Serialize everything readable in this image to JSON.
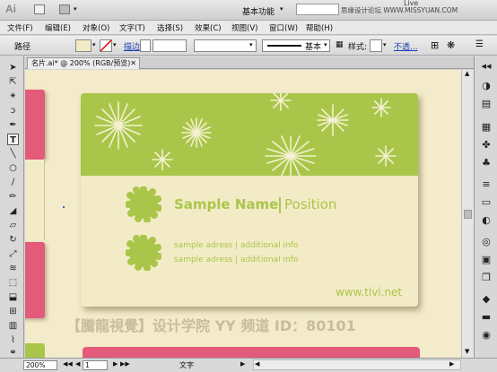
{
  "titlebar": {
    "logo": "Ai",
    "workspace": "基本功能",
    "watermark_site": "思缘设计论坛 WWW.MISSYUAN.COM",
    "live_label": "Live"
  },
  "menu": [
    "文件(F)",
    "编辑(E)",
    "对象(O)",
    "文字(T)",
    "选择(S)",
    "效果(C)",
    "视图(V)",
    "窗口(W)",
    "帮助(H)"
  ],
  "control": {
    "object_type": "路径",
    "stroke_label": "描边",
    "stroke_style": "基本",
    "opacity_style_label": "样式:",
    "opacity_label": "不透..."
  },
  "doc_tab": "名片.ai* @ 200% (RGB/预览)",
  "card": {
    "name": "Sample Name",
    "position": "Position",
    "address1": "sample adress | additional info",
    "address2": "sample adress | additional info",
    "website": "www.tlvi.net"
  },
  "overlay_watermark": "【騰龍視覺】设计学院  YY 频道 ID：80101",
  "status": {
    "zoom": "200%",
    "page": "1",
    "mode": "文字"
  },
  "colors": {
    "card_green": "#a9c64a",
    "card_cream": "#f3ebc6",
    "pink": "#e35a7a"
  }
}
